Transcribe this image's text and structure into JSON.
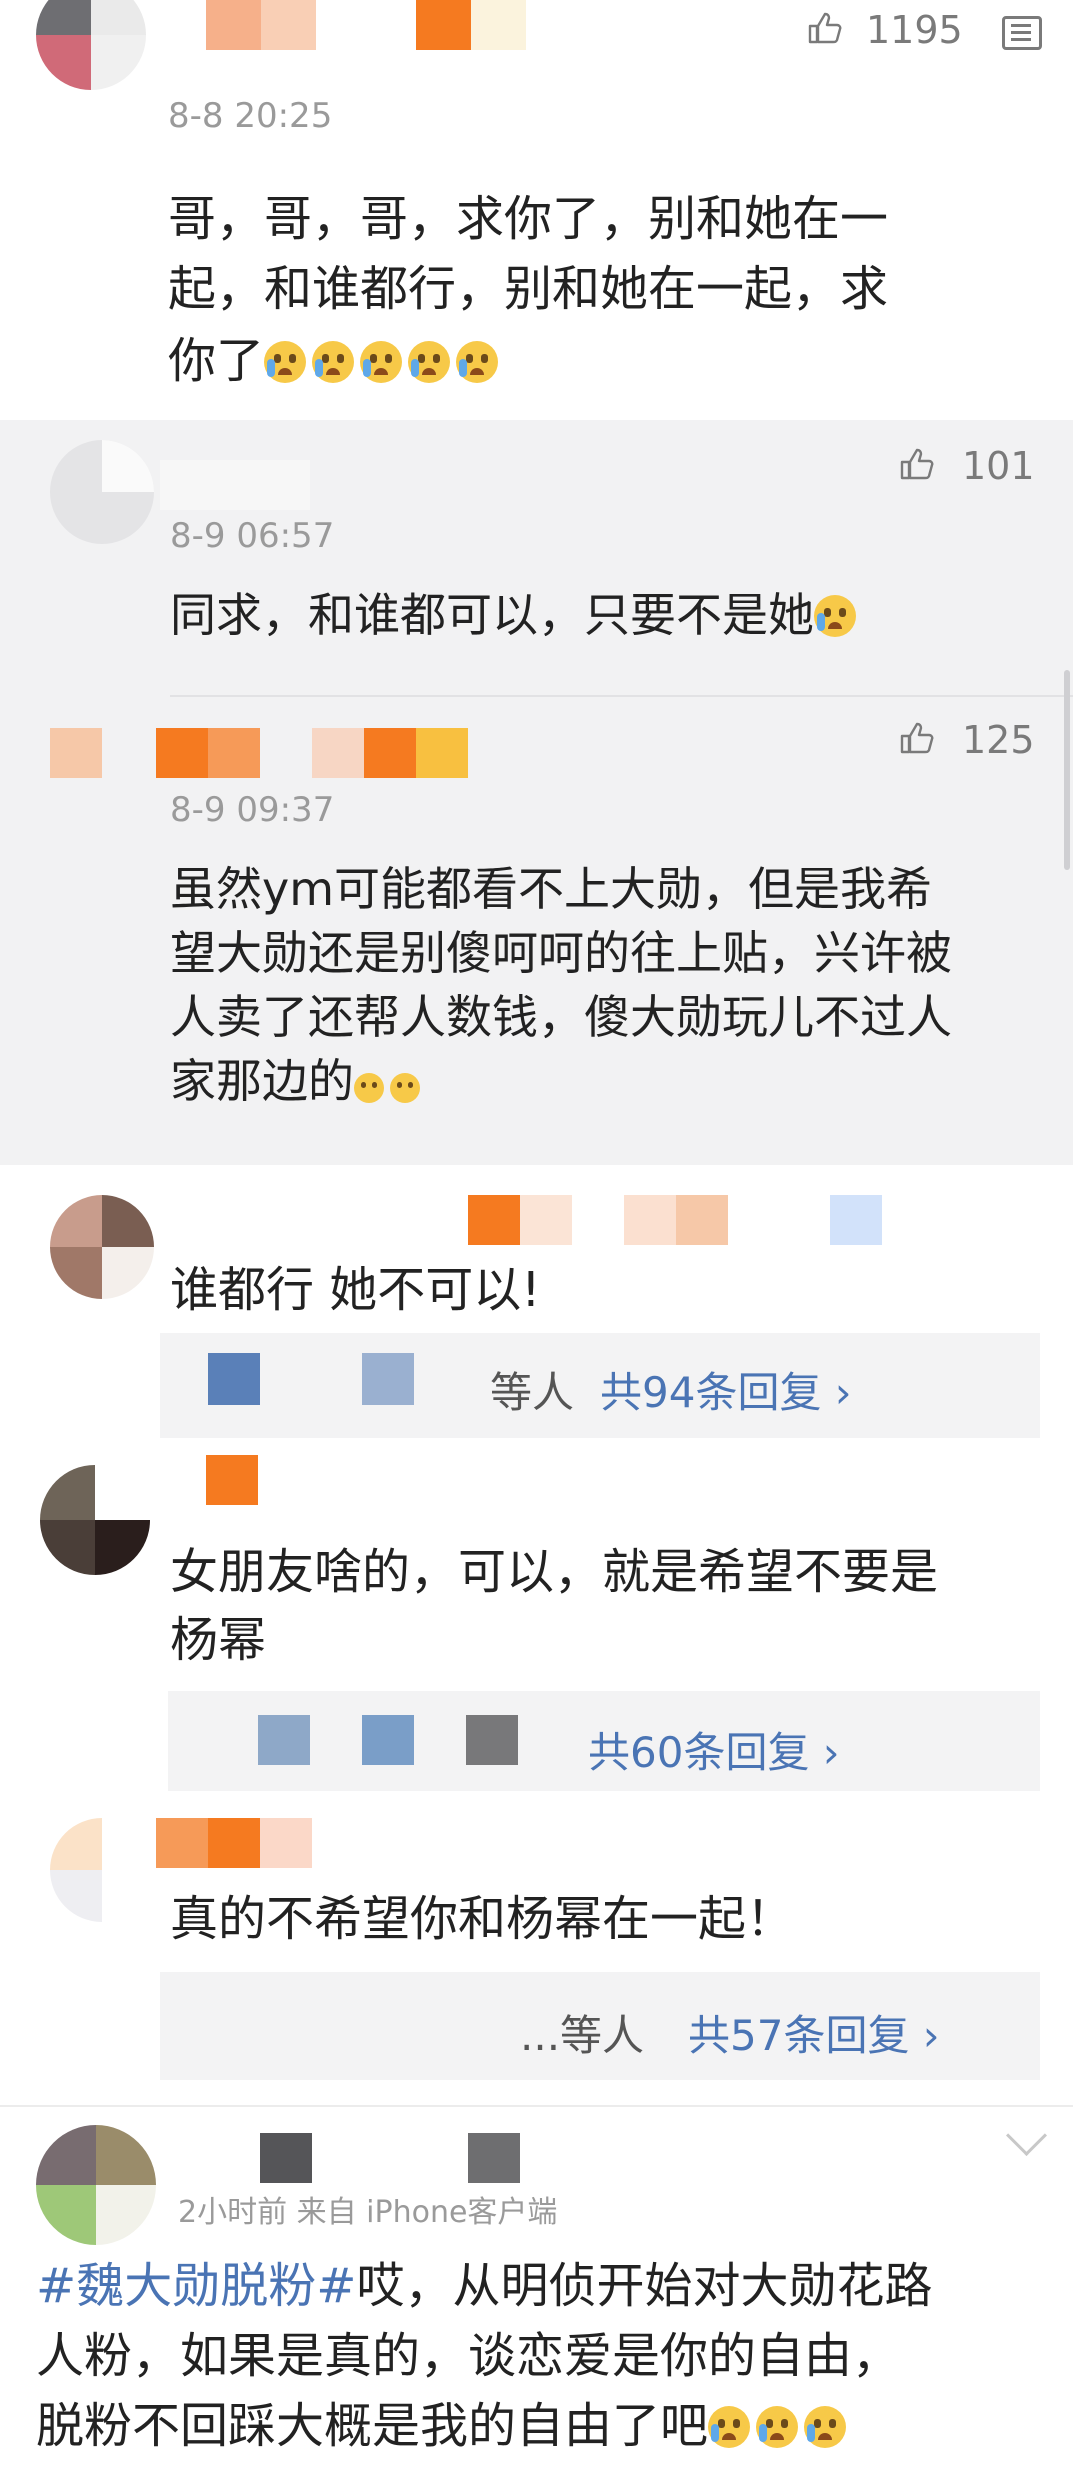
{
  "colors": {
    "link": "#4a74b4",
    "nested_bg": "#f2f2f3",
    "text": "#222222",
    "meta": "#9a9a9a"
  },
  "comment1": {
    "timestamp": "8-8 20:25",
    "likes": "1195",
    "text_line1": "哥，哥，哥，求你了，别和她在一",
    "text_line2": "起，和谁都行，别和她在一起，求",
    "text_line3": "你了",
    "emoji_count": 5,
    "icons": [
      "thumbs-up-icon",
      "comment-icon"
    ]
  },
  "sub1": {
    "timestamp": "8-9 06:57",
    "likes": "101",
    "text": "同求，和谁都可以，只要不是她"
  },
  "sub2": {
    "timestamp": "8-9 09:37",
    "likes": "125",
    "text_line1": "虽然ym可能都看不上大勋，但是我希",
    "text_line2": "望大勋还是别傻呵呵的往上贴，兴许被",
    "text_line3": "人卖了还帮人数钱，傻大勋玩儿不过人",
    "text_line4": "家那边的"
  },
  "comment2": {
    "text": "谁都行 她不可以!",
    "reply_names": "等人",
    "reply_link": "共94条回复 ›"
  },
  "comment3": {
    "text_line1": "女朋友啥的，可以，就是希望不要是",
    "text_line2": "杨幂",
    "reply_link": "共60条回复 ›"
  },
  "comment4": {
    "text": "真的不希望你和杨幂在一起！",
    "reply_names": "...等人",
    "reply_link": "共57条回复 ›"
  },
  "comment5": {
    "meta": "2小时前  来自 iPhone客户端",
    "hashtag": "#魏大勋脱粉#",
    "text_line1_rest": "哎，从明侦开始对大勋花路",
    "text_line2": "人粉，如果是真的，谈恋爱是你的自由，",
    "text_line3": "脱粉不回踩大概是我的自由了吧"
  }
}
